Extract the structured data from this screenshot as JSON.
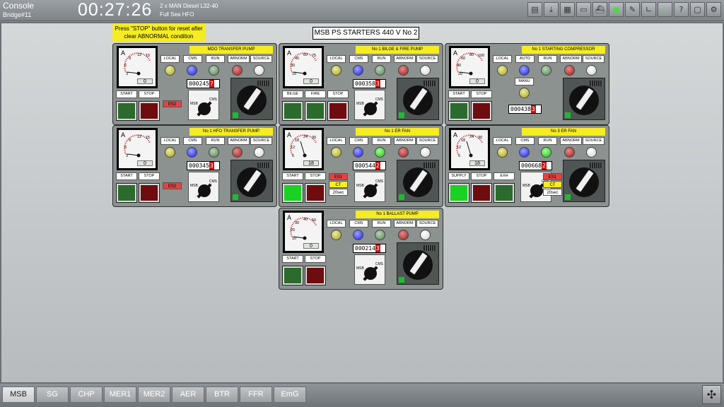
{
  "header": {
    "title": "Console",
    "subtitle": "Bridge#11",
    "clock": "00:27:26",
    "engine_line1": "2 x MAN Diesel L32-40",
    "engine_line2": "Full Sea HFO"
  },
  "toolbar_icons": [
    "print-icon",
    "download-icon",
    "document-icon",
    "truck-icon",
    "ship-icon",
    "engine-icon",
    "pen-icon",
    "chart-icon",
    "comment-icon",
    "help-icon",
    "window-icon",
    "settings-icon"
  ],
  "notice": "Press \"STOP\" button for reset after clear ABNORMAL condition",
  "page_title": "MSB PS STARTERS  440 V No 2",
  "labels": {
    "local": "LOCAL",
    "cms": "CMS",
    "run": "RUN",
    "abnorm": "ABNORM",
    "source": "SOURCE",
    "auto": "AUTO",
    "start": "START",
    "stop": "STOP",
    "msb": "MSB",
    "es1": "ES1",
    "es2": "ES2",
    "ct": "CT",
    "sec20": "20sec",
    "manu": "MANU",
    "bilge": "BILGE",
    "fire": "FIRE",
    "supply": "SUPPLY",
    "exh": "EXH",
    "ammeter": "A"
  },
  "panels": [
    {
      "title": "MDO TRANSFER PUMP",
      "counter": "000245",
      "counter_last": "7",
      "reading": "0",
      "scale": [
        "3",
        "6",
        "9",
        "12",
        "15"
      ]
    },
    {
      "title": "No 1 BILGE & FIRE  PUMP",
      "counter": "000358",
      "counter_last": "3",
      "reading": "0",
      "scale": [
        "15",
        "30",
        "45",
        "60",
        "75"
      ]
    },
    {
      "title": "No 1 STARTING COMPRESSOR",
      "counter": "000438",
      "counter_last": "3",
      "reading": "0",
      "scale": [
        "20",
        "40",
        "60",
        "80",
        "100"
      ]
    },
    {
      "title": "No 1 HFO TRANSFER PUMP",
      "counter": "000345",
      "counter_last": "3",
      "reading": "0",
      "scale": [
        "3",
        "6",
        "9",
        "12",
        "15"
      ]
    },
    {
      "title": "No 1 ER FAN",
      "counter": "000544",
      "counter_last": "2",
      "reading": "18",
      "scale": [
        "6",
        "12",
        "18",
        "24",
        "30"
      ]
    },
    {
      "title": "No 3 ER FAN",
      "counter": "000668",
      "counter_last": "2",
      "reading": "18",
      "scale": [
        "6",
        "12",
        "18",
        "24",
        "30"
      ]
    },
    {
      "title": "No 1 BALLAST PUMP",
      "counter": "000214",
      "counter_last": "3",
      "reading": "0",
      "scale": [
        "10",
        "20",
        "30",
        "40",
        "50"
      ]
    }
  ],
  "tabs": [
    "MSB",
    "SG",
    "CHP",
    "MER1",
    "MER2",
    "AER",
    "BTR",
    "FFR",
    "EmG"
  ],
  "active_tab": "MSB",
  "colors": {
    "badge": "#f5ec21",
    "panel": "#8c9290",
    "lamp_blue": "#1e1ee0",
    "lamp_green_on": "#18c220",
    "alarm_red": "#e14444"
  }
}
